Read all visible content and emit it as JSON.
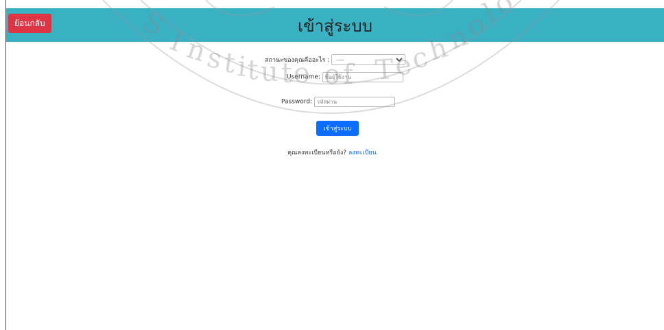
{
  "header": {
    "back_label": "ย้อนกลับ",
    "title": "เข้าสู่ระบบ",
    "bg_color": "#3ab0c3",
    "back_color": "#dc3545"
  },
  "form": {
    "status_label": "สถานะของคุณคืออะไร :",
    "status_selected": "----",
    "username_label": "Username:",
    "username_placeholder": "ชื่อผู้ใช้งาน",
    "password_label": "Password:",
    "password_placeholder": "รหัสผ่าน",
    "submit_label": "เข้าสู่ระบบ",
    "submit_color": "#0d6efd"
  },
  "register": {
    "prompt": "คุณลงทะเบียนหรือยัง?",
    "link_label": "ลงทะเบียน"
  }
}
